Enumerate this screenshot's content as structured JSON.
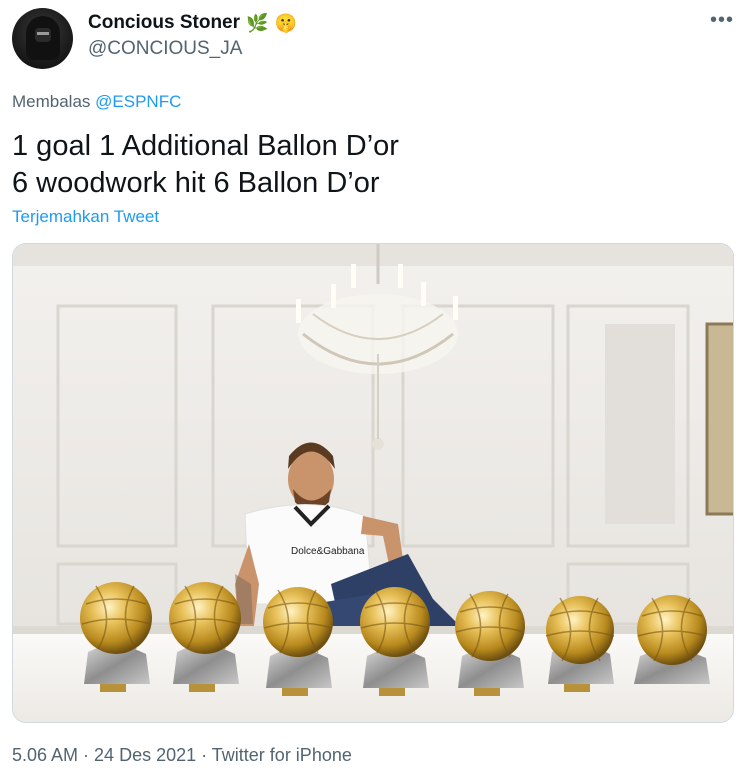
{
  "author": {
    "display_name": "Concious Stoner",
    "emojis": [
      "🌿",
      "🤫"
    ],
    "handle": "@CONCIOUS_JA"
  },
  "menu": {
    "more_label": "•••"
  },
  "reply": {
    "prefix": "Membalas",
    "mention": "@ESPNFC"
  },
  "tweet": {
    "lines": [
      "1 goal 1 Additional Ballon D’or",
      "6 woodwork hit 6 Ballon D’or"
    ]
  },
  "translate_label": "Terjemahkan Tweet",
  "photo": {
    "shirt_text": "Dolce&Gabbana",
    "trophy_count": 7
  },
  "footer": {
    "time": "5.06 AM",
    "separator": " · ",
    "date": "24 Des 2021",
    "client": "Twitter for iPhone"
  },
  "colors": {
    "link": "#1d9bf0",
    "secondary": "#536471",
    "text": "#0f1419"
  },
  "icons": [
    "avatar",
    "more-icon"
  ]
}
